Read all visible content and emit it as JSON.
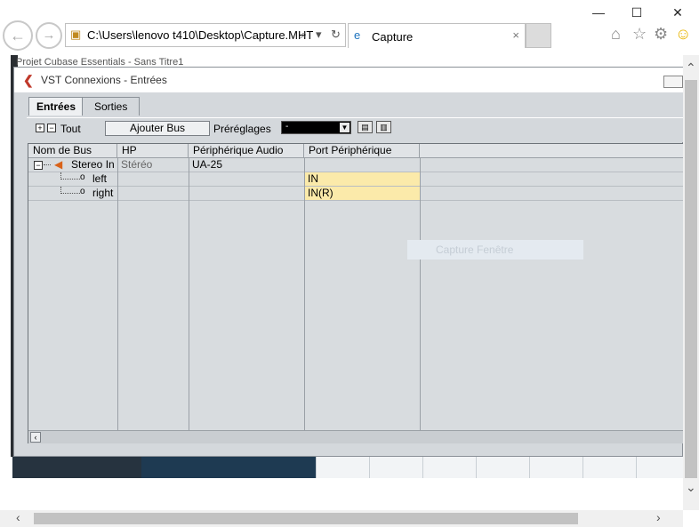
{
  "browser": {
    "address": "C:\\Users\\lenovo t410\\Desktop\\Capture.MHT",
    "tab_title": "Capture",
    "tab_close": "×",
    "search_glyph": "⌕",
    "dropdown_glyph": "▾",
    "refresh_glyph": "↻"
  },
  "page": {
    "caption": "Projet Cubase Essentials - Sans Titre1",
    "watermark": "Capture Fenêtre"
  },
  "vst": {
    "title": "VST Connexions - Entrées",
    "tabs": [
      {
        "label": "Entrées"
      },
      {
        "label": "Sorties"
      }
    ],
    "toolbar": {
      "all_label": "Tout",
      "add_bus_label": "Ajouter Bus",
      "presets_label": "Préréglages",
      "presets_value": "-"
    },
    "columns": [
      "Nom de Bus",
      "HP",
      "Périphérique Audio",
      "Port Périphérique"
    ],
    "rows": [
      {
        "name": "Stereo In",
        "hp": "Stéréo",
        "device": "UA-25",
        "port": ""
      },
      {
        "name": "left",
        "hp": "",
        "device": "",
        "port": "IN"
      },
      {
        "name": "right",
        "hp": "",
        "device": "",
        "port": "IN(R)"
      }
    ]
  },
  "colors": {
    "port_highlight": "#fbeaaa",
    "window_bg": "#d4d8dc",
    "logo": "#c0392b"
  }
}
